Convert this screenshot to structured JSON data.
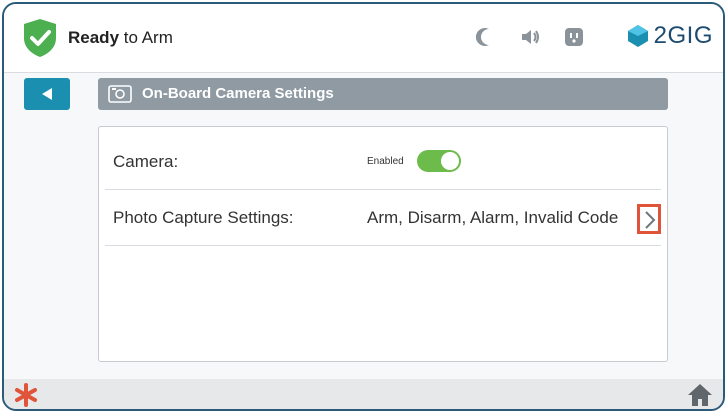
{
  "status": {
    "ready_word": "Ready",
    "rest": " to Arm"
  },
  "brand": {
    "name": "2GIG"
  },
  "icons": {
    "shield": "shield-check-icon",
    "night": "moon-icon",
    "volume": "speaker-icon",
    "outlet": "outlet-icon",
    "brand_logo": "2gig-logo-icon",
    "back": "back-arrow-icon",
    "camera": "camera-icon",
    "chevron": "chevron-right-icon",
    "emergency": "asterisk-icon",
    "home": "home-icon"
  },
  "colors": {
    "accent": "#1a8fb0",
    "success": "#6dbb4a",
    "highlight": "#e0543a",
    "brand": "#1d4c70"
  },
  "header": {
    "title": "On-Board Camera Settings"
  },
  "settings": {
    "camera_label": "Camera:",
    "camera_state": "Enabled",
    "camera_enabled": true,
    "photo_label": "Photo Capture Settings:",
    "photo_value": "Arm, Disarm, Alarm, Invalid Code"
  }
}
